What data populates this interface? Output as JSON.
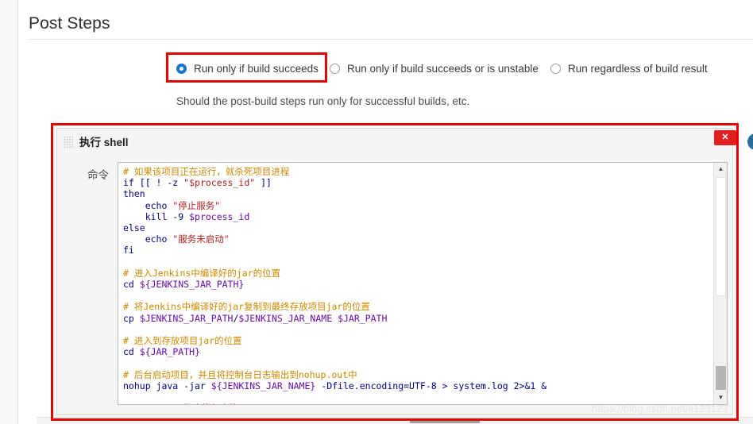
{
  "section": {
    "title": "Post Steps",
    "helper_text": "Should the post-build steps run only for successful builds, etc."
  },
  "radio_group": {
    "name": "post-build-run-condition",
    "selected_index": 0,
    "options": [
      {
        "label": "Run only if build succeeds",
        "checked": true
      },
      {
        "label": "Run only if build succeeds or is unstable",
        "checked": false
      },
      {
        "label": "Run regardless of build result",
        "checked": false
      }
    ]
  },
  "builder": {
    "title": "执行 shell",
    "close_label": "✕",
    "help_label": "?",
    "field_label": "命令",
    "command_lines": [
      {
        "type": "comment",
        "text": "# 如果该项目正在运行，就杀死项目进程"
      },
      {
        "type": "code",
        "text": "if [[ ! -z \"$process_id\" ]]"
      },
      {
        "type": "code",
        "text": "then"
      },
      {
        "type": "code",
        "text": "    echo \"停止服务\""
      },
      {
        "type": "code",
        "text": "    kill -9 $process_id"
      },
      {
        "type": "code",
        "text": "else"
      },
      {
        "type": "code",
        "text": "    echo \"服务未启动\""
      },
      {
        "type": "code",
        "text": "fi"
      },
      {
        "type": "blank",
        "text": ""
      },
      {
        "type": "comment",
        "text": "# 进入Jenkins中编译好的jar的位置"
      },
      {
        "type": "code",
        "text": "cd ${JENKINS_JAR_PATH}"
      },
      {
        "type": "blank",
        "text": ""
      },
      {
        "type": "comment",
        "text": "# 将Jenkins中编译好的jar复制到最终存放项目jar的位置"
      },
      {
        "type": "code",
        "text": "cp $JENKINS_JAR_PATH/$JENKINS_JAR_NAME $JAR_PATH"
      },
      {
        "type": "blank",
        "text": ""
      },
      {
        "type": "comment",
        "text": "# 进入到存放项目jar的位置"
      },
      {
        "type": "code",
        "text": "cd ${JAR_PATH}"
      },
      {
        "type": "blank",
        "text": ""
      },
      {
        "type": "comment",
        "text": "# 后台启动项目，并且将控制台日志输出到nohup.out中"
      },
      {
        "type": "code",
        "text": "nohup java -jar ${JENKINS_JAR_NAME} -Dfile.encoding=UTF-8 > system.log 2>&1 &"
      },
      {
        "type": "blank",
        "text": ""
      },
      {
        "type": "code",
        "text": "echo \"shell脚本执行完毕\""
      }
    ],
    "command_text": "# 如果该项目正在运行，就杀死项目进程\nif [[ ! -z \"$process_id\" ]]\nthen\n    echo \"停止服务\"\n    kill -9 $process_id\nelse\n    echo \"服务未启动\"\nfi\n\n# 进入Jenkins中编译好的jar的位置\ncd ${JENKINS_JAR_PATH}\n\n# 将Jenkins中编译好的jar复制到最终存放项目jar的位置\ncp $JENKINS_JAR_PATH/$JENKINS_JAR_NAME $JAR_PATH\n\n# 进入到存放项目jar的位置\ncd ${JAR_PATH}\n\n# 后台启动项目，并且将控制台日志输出到nohup.out中\nnohup java -jar ${JENKINS_JAR_NAME} -Dfile.encoding=UTF-8 > system.log 2>&1 &\n\necho \"shell脚本执行完毕\""
  },
  "scrollbar": {
    "up_arrow": "▲",
    "down_arrow": "▼"
  },
  "watermark": {
    "text": "https://blog.csdn.net/li123123"
  },
  "colors": {
    "accent_blue": "#1675d1",
    "annotation_red": "#e60000",
    "comment_orange": "#cc8800",
    "string_red": "#b22222",
    "code_navy": "#000080",
    "variable_purple": "#6a0dad",
    "help_blue": "#2b6e9c"
  }
}
